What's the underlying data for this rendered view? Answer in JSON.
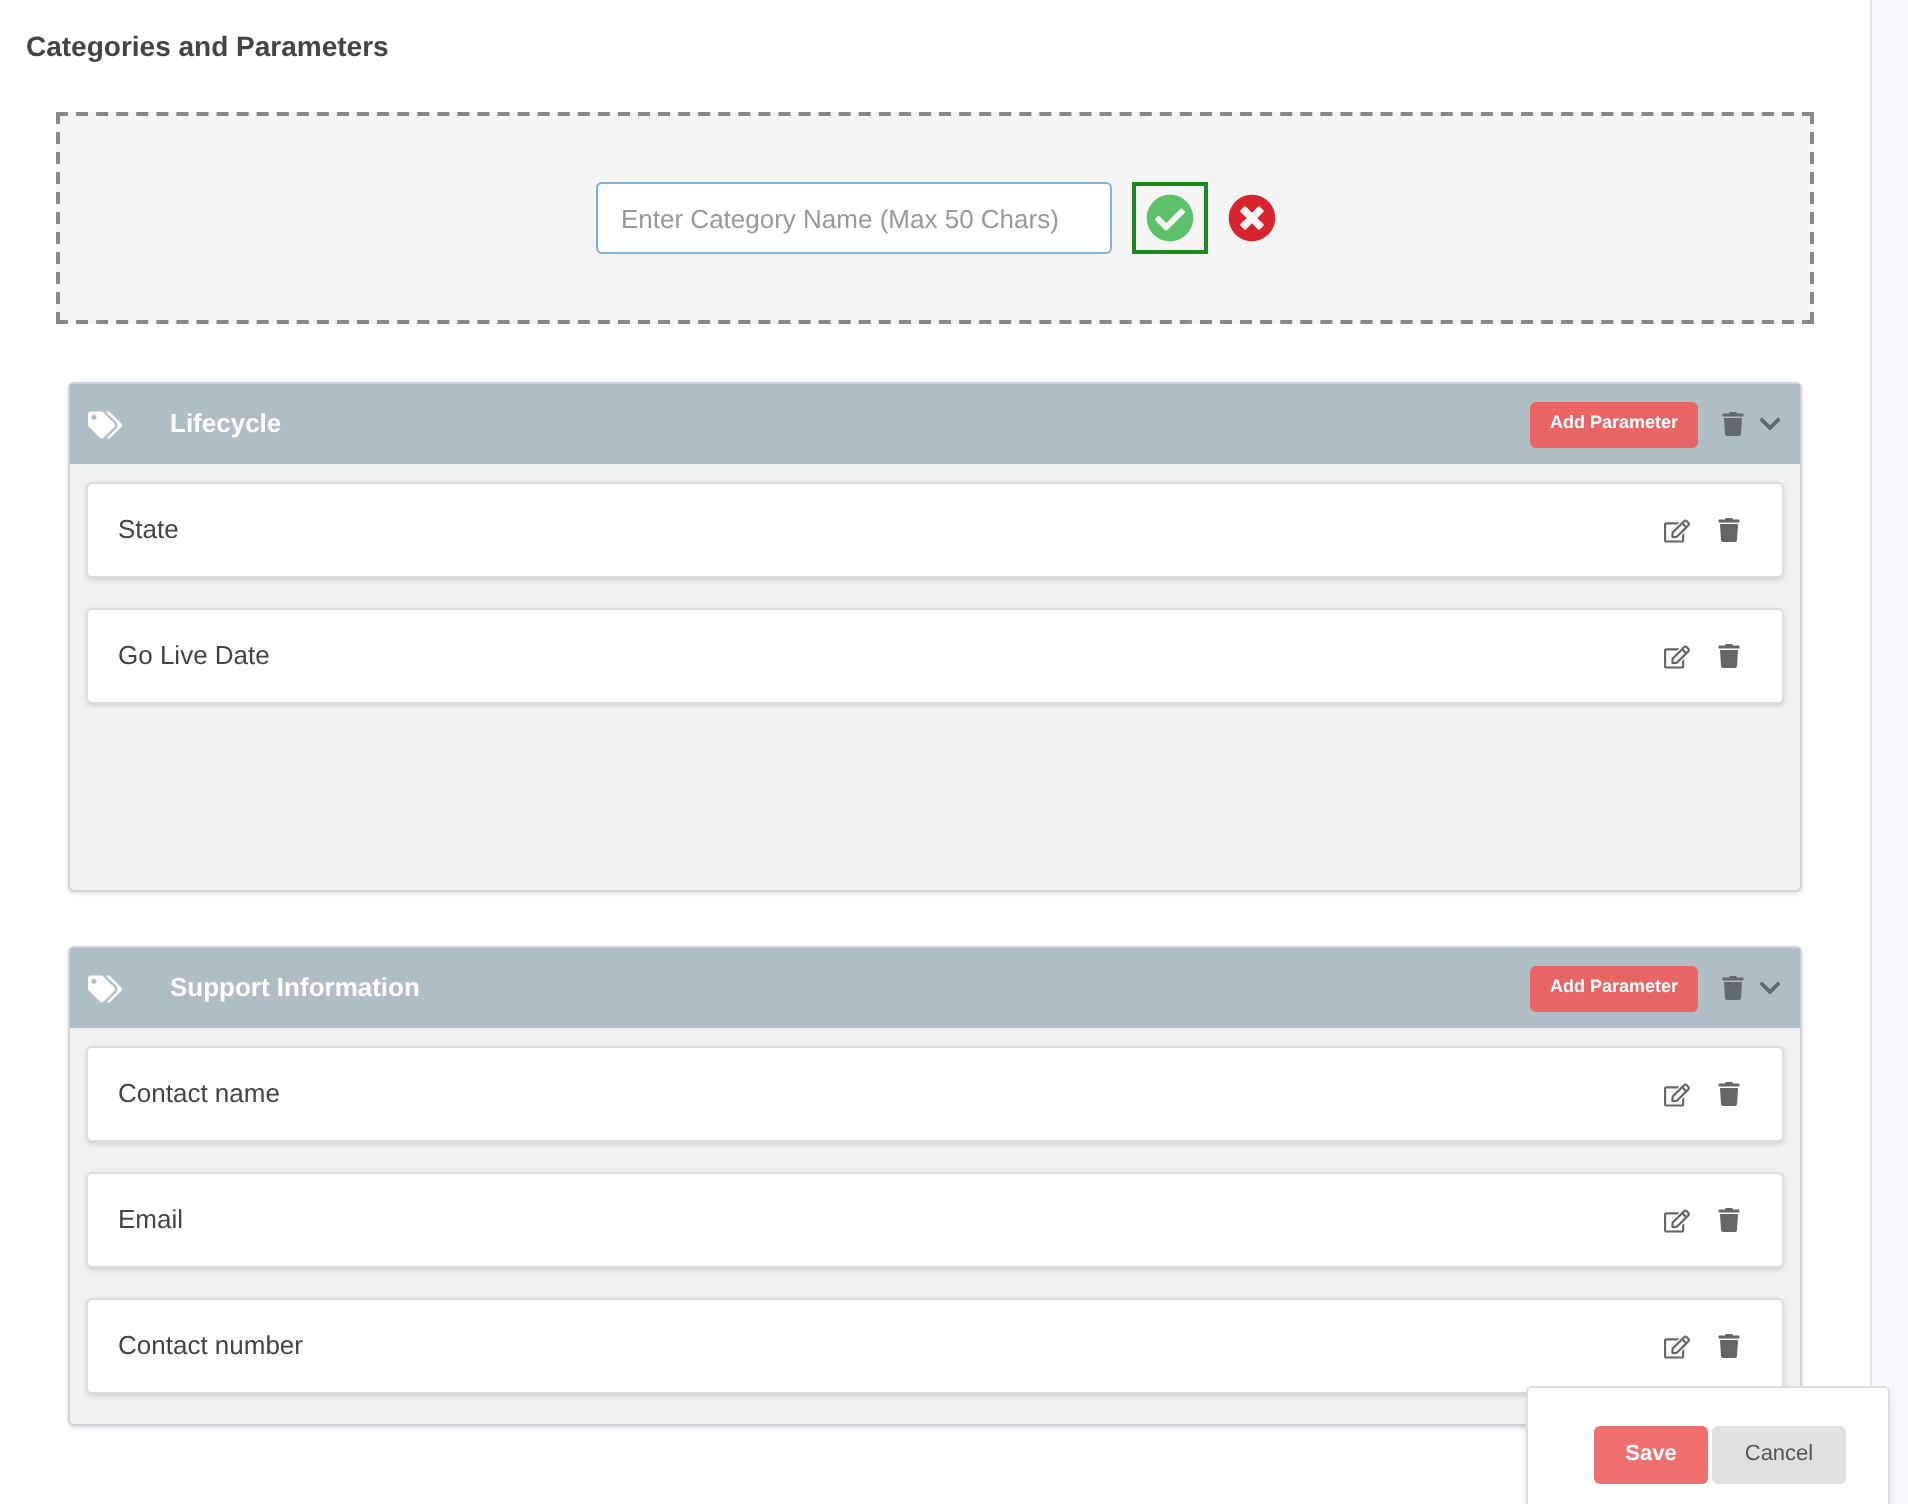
{
  "title": "Categories and Parameters",
  "new_category": {
    "placeholder": "Enter Category Name (Max 50 Chars)"
  },
  "categories": [
    {
      "name": "Lifecycle",
      "add_button": "Add Parameter",
      "expanded": true,
      "parameters": [
        {
          "name": "State"
        },
        {
          "name": "Go Live Date"
        }
      ]
    },
    {
      "name": "Support Information",
      "add_button": "Add Parameter",
      "expanded": true,
      "parameters": [
        {
          "name": "Contact name"
        },
        {
          "name": "Email"
        },
        {
          "name": "Contact number"
        }
      ]
    }
  ],
  "footer": {
    "save": "Save",
    "cancel": "Cancel"
  }
}
